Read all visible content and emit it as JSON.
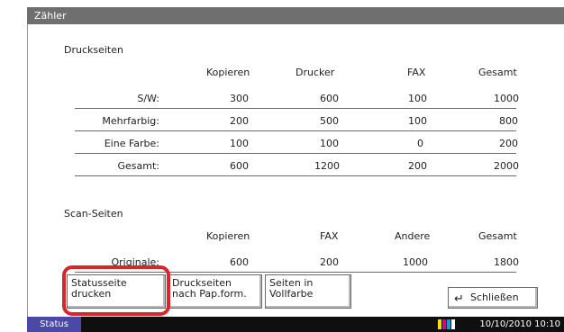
{
  "title": "Zähler",
  "print_section": {
    "title": "Druckseiten",
    "headers": [
      "Kopieren",
      "Drucker",
      "FAX",
      "Gesamt"
    ],
    "rows": [
      {
        "label": "S/W:",
        "values": [
          "300",
          "600",
          "100",
          "1000"
        ]
      },
      {
        "label": "Mehrfarbig:",
        "values": [
          "200",
          "500",
          "100",
          "800"
        ]
      },
      {
        "label": "Eine Farbe:",
        "values": [
          "100",
          "100",
          "0",
          "200"
        ]
      },
      {
        "label": "Gesamt:",
        "values": [
          "600",
          "1200",
          "200",
          "2000"
        ]
      }
    ]
  },
  "scan_section": {
    "title": "Scan-Seiten",
    "headers": [
      "Kopieren",
      "FAX",
      "Andere",
      "Gesamt"
    ],
    "rows": [
      {
        "label": "Originale:",
        "values": [
          "600",
          "200",
          "1000",
          "1800"
        ]
      }
    ]
  },
  "buttons": {
    "status_print_line1": "Statusseite",
    "status_print_line2": "drucken",
    "paper_print_line1": "Druckseiten",
    "paper_print_line2": "nach Pap.form.",
    "color_line1": "Seiten in",
    "color_line2": "Vollfarbe",
    "close": "Schließen"
  },
  "statusbar": {
    "status_label": "Status",
    "datetime": "10/10/2010  10:10"
  },
  "colors": {
    "highlight": "#d9262b",
    "status_tab": "#4a49a8",
    "toner_cyan": "#00a0e0",
    "toner_magenta": "#e0007a",
    "toner_yellow": "#f5e000",
    "toner_black": "#111111"
  }
}
